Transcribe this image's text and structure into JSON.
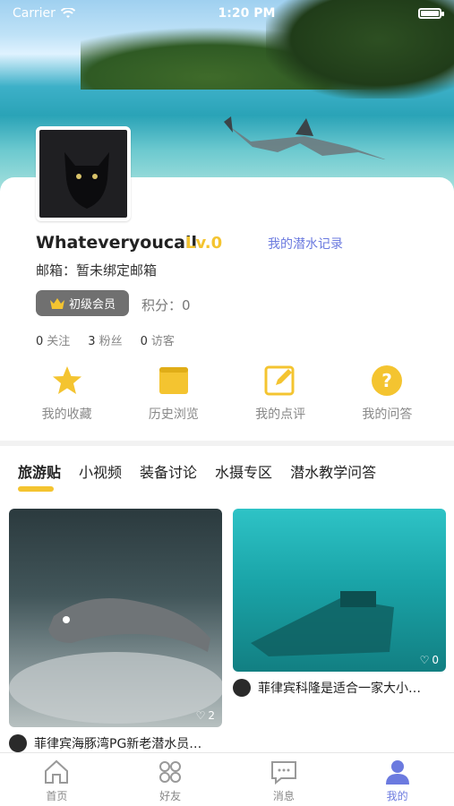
{
  "statusbar": {
    "carrier": "Carrier",
    "time": "1:20 PM"
  },
  "profile": {
    "username": "Whateveryoucall",
    "level": "Lv.0",
    "dive_record_link": "我的潜水记录",
    "email_line": "邮箱：暂未绑定邮箱",
    "member_badge": "初级会员",
    "points_line": "积分：0",
    "stats": [
      {
        "count": "0",
        "label": "关注"
      },
      {
        "count": "3",
        "label": "粉丝"
      },
      {
        "count": "0",
        "label": "访客"
      }
    ]
  },
  "quick_actions": [
    {
      "icon": "star-icon",
      "label": "我的收藏"
    },
    {
      "icon": "history-icon",
      "label": "历史浏览"
    },
    {
      "icon": "edit-icon",
      "label": "我的点评"
    },
    {
      "icon": "question-icon",
      "label": "我的问答"
    }
  ],
  "tabs": [
    {
      "label": "旅游贴",
      "active": true
    },
    {
      "label": "小视频",
      "active": false
    },
    {
      "label": "装备讨论",
      "active": false
    },
    {
      "label": "水摄专区",
      "active": false
    },
    {
      "label": "潜水教学问答",
      "active": false
    }
  ],
  "posts": [
    {
      "title": "菲律宾海豚湾PG新老潜水员…",
      "likes": "2"
    },
    {
      "title": "菲律宾科隆是适合一家大小…",
      "likes": "0"
    }
  ],
  "bottom_nav": [
    {
      "label": "首页",
      "icon": "home-icon",
      "active": false
    },
    {
      "label": "好友",
      "icon": "friends-icon",
      "active": false
    },
    {
      "label": "消息",
      "icon": "message-icon",
      "active": false
    },
    {
      "label": "我的",
      "icon": "profile-icon",
      "active": true
    }
  ],
  "colors": {
    "accent_yellow": "#f4c430",
    "link_blue": "#6b7adf",
    "badge_gray": "#707070"
  }
}
